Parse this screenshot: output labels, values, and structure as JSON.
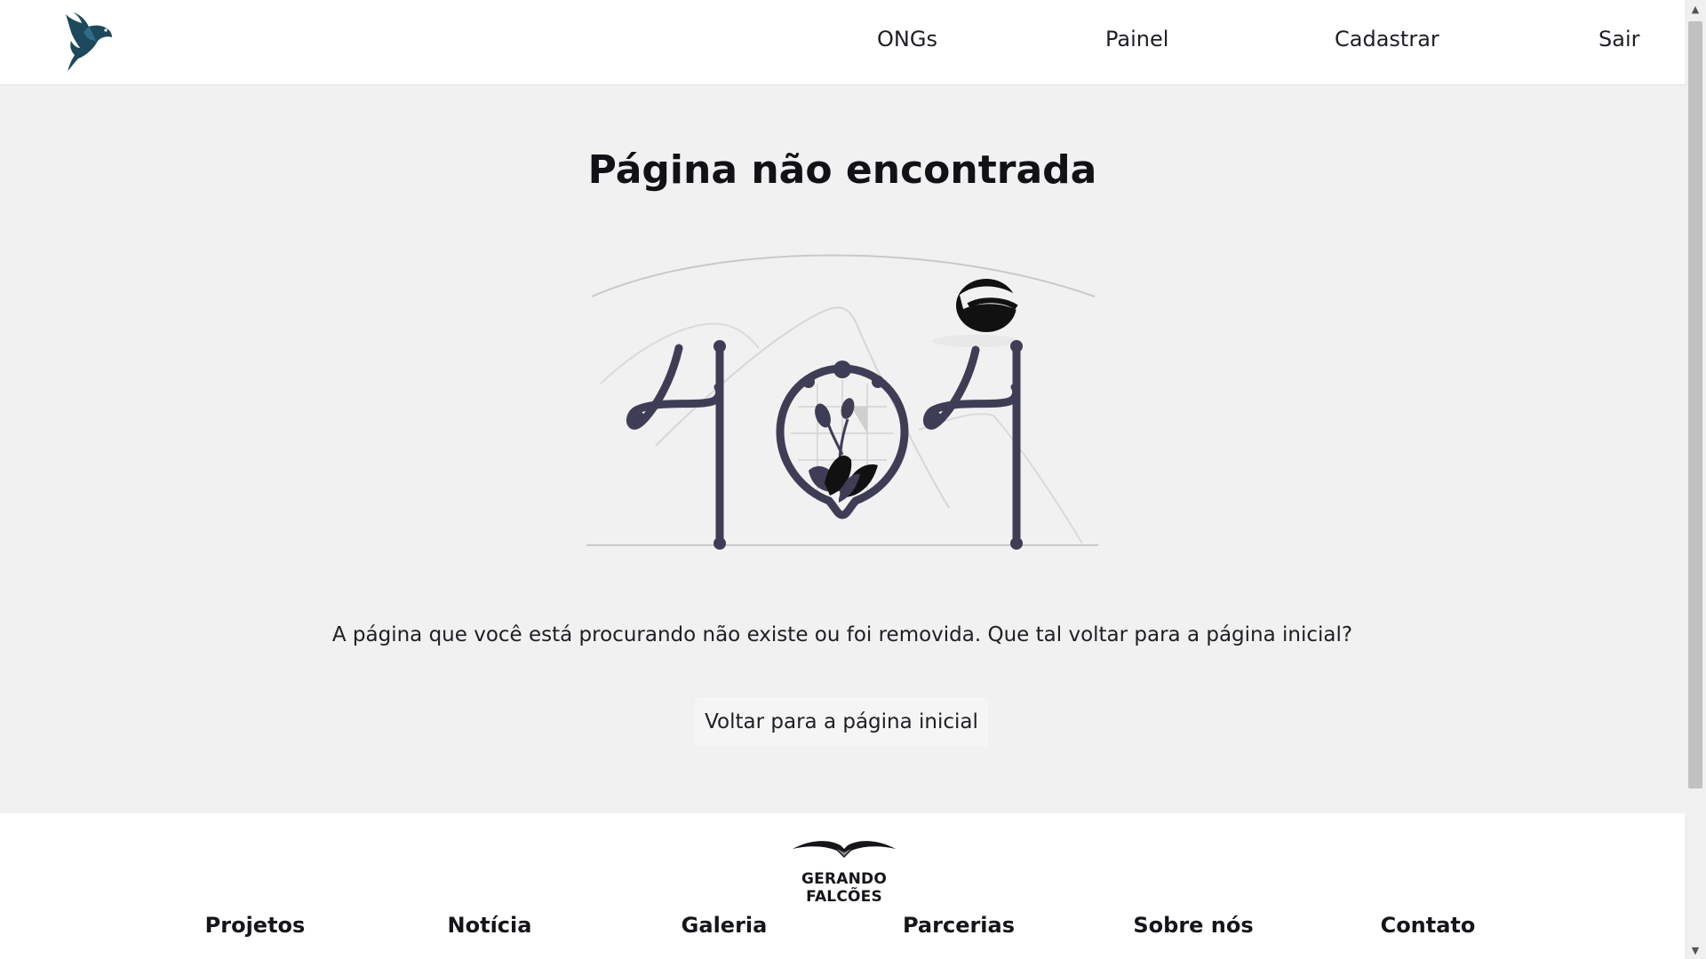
{
  "header": {
    "logo_icon": "bird-logo-icon",
    "nav": [
      {
        "label": "ONGs"
      },
      {
        "label": "Painel"
      },
      {
        "label": "Cadastrar"
      },
      {
        "label": "Sair"
      }
    ]
  },
  "main": {
    "title": "Página não encontrada",
    "illustration_icon": "404-illustration",
    "message": "A página que você está procurando não existe ou foi removida. Que tal voltar para a página inicial?",
    "button_label": "Voltar para a página inicial"
  },
  "footer": {
    "brand": "GERANDO FALCÕES",
    "brand_icon": "falcon-wings-logo",
    "links": [
      {
        "label": "Projetos"
      },
      {
        "label": "Notícia"
      },
      {
        "label": "Galeria"
      },
      {
        "label": "Parcerias"
      },
      {
        "label": "Sobre nós"
      },
      {
        "label": "Contato"
      }
    ]
  },
  "colors": {
    "main_background": "#f1f1f1",
    "illustration_ink": "#3f3d56",
    "logo_teal": "#1c4a5c"
  }
}
